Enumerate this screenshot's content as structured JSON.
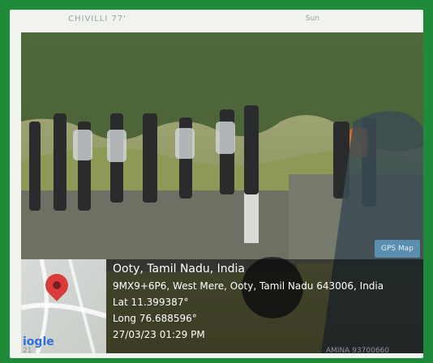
{
  "captions": {
    "top_left": "CHIVILLI 77'",
    "top_right": "Sun",
    "bottom_left": "21",
    "bottom_right": "AMINA 93700660"
  },
  "map": {
    "brand": "iogle",
    "pin_icon": "location-pin-icon"
  },
  "location": {
    "title": "Ooty, Tamil Nadu, India",
    "address": "9MX9+6P6, West Mere, Ooty, Tamil Nadu 643006, India",
    "lat": "Lat 11.399387°",
    "long": "Long 76.688596°",
    "datetime": "27/03/23 01:29 PM"
  },
  "badge": {
    "label": "GPS Map"
  },
  "colors": {
    "border": "#1f8a3a",
    "overlay": "#000000"
  }
}
